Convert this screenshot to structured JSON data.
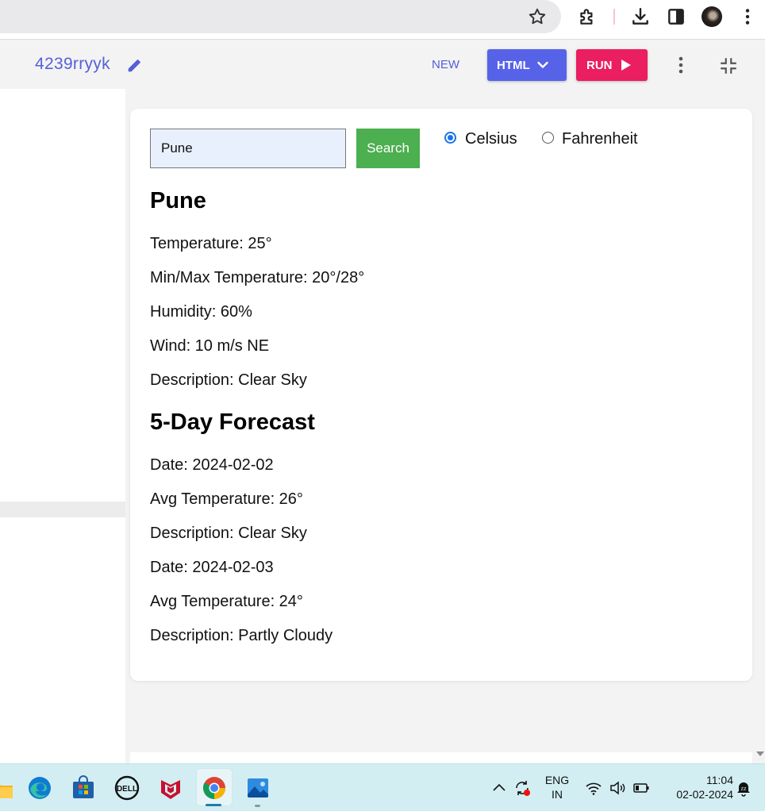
{
  "app": {
    "project_name": "4239rryyk",
    "new_label": "NEW",
    "html_label": "HTML",
    "run_label": "RUN"
  },
  "weather": {
    "search_value": "Pune",
    "search_button": "Search",
    "unit_celsius": "Celsius",
    "unit_fahrenheit": "Fahrenheit",
    "selected_unit": "Celsius",
    "city": "Pune",
    "current": [
      "Temperature: 25°",
      "Min/Max Temperature: 20°/28°",
      "Humidity: 60%",
      "Wind: 10 m/s NE",
      "Description: Clear Sky"
    ],
    "forecast_title": "5-Day Forecast",
    "forecast": [
      "Date: 2024-02-02",
      "Avg Temperature: 26°",
      "Description: Clear Sky",
      "Date: 2024-02-03",
      "Avg Temperature: 24°",
      "Description: Partly Cloudy"
    ]
  },
  "taskbar": {
    "apps": [
      "file-explorer",
      "edge",
      "microsoft-store",
      "dell",
      "mcafee",
      "chrome",
      "photos"
    ],
    "lang_1": "ENG",
    "lang_2": "IN",
    "time": "11:04",
    "date": "02-02-2024"
  },
  "colors": {
    "accent": "#5663e8",
    "run": "#ea1e60",
    "search_button": "#4caf50",
    "taskbar": "#d3eef2"
  }
}
